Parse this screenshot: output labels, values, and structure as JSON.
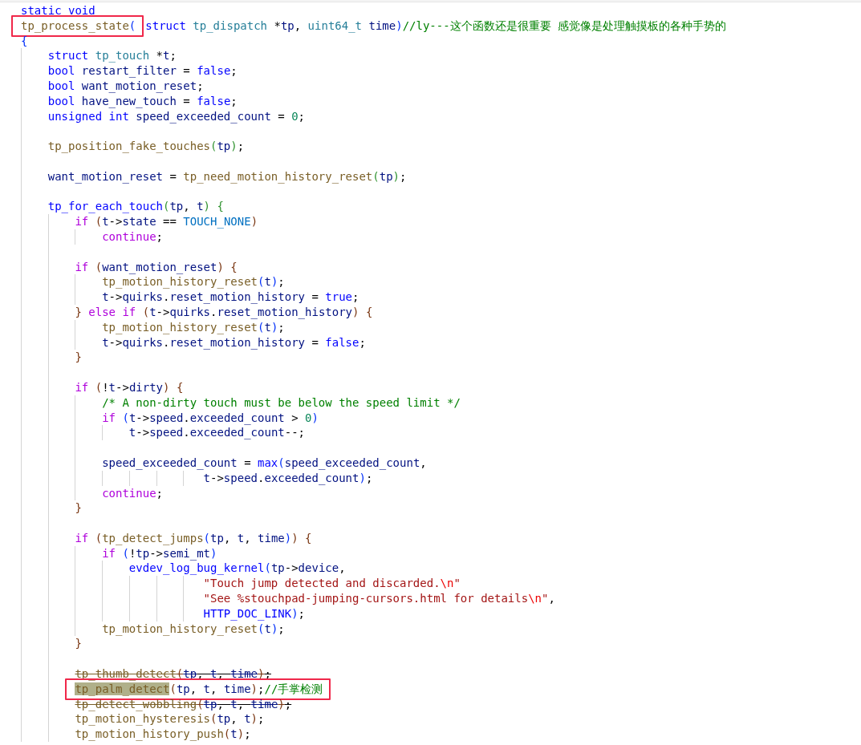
{
  "editor": {
    "lines": [
      {
        "kind": "code",
        "tokens": [
          {
            "text": "static void",
            "kind": "keyword"
          }
        ]
      },
      {
        "kind": "code",
        "boxed": [
          {
            "text": "tp_process_state",
            "kind": "function"
          },
          {
            "text": "(",
            "kind": "bracket"
          }
        ],
        "after": [
          {
            "text": "struct ",
            "kind": "keyword"
          },
          {
            "text": "tp_dispatch",
            "kind": "type"
          },
          {
            "text": " *",
            "kind": "plain"
          },
          {
            "text": "tp",
            "kind": "variable"
          },
          {
            "text": ", ",
            "kind": "plain"
          },
          {
            "text": "uint64_t",
            "kind": "type"
          },
          {
            "text": " time",
            "kind": "variable"
          },
          {
            "text": ")",
            "kind": "bracket"
          },
          {
            "text": "//ly---这个函数还是很重要 感觉像是处理触摸板的各种手势的",
            "kind": "comment"
          }
        ]
      },
      {
        "kind": "code",
        "tokens": [
          {
            "text": "{",
            "kind": "bracket"
          }
        ],
        "children": [
          {
            "kind": "code",
            "tokens": [
              {
                "text": "struct ",
                "kind": "keyword"
              },
              {
                "text": "tp_touch",
                "kind": "type"
              },
              {
                "text": " *",
                "kind": "plain"
              },
              {
                "text": "t",
                "kind": "variable"
              },
              {
                "text": ";",
                "kind": "plain"
              }
            ]
          },
          {
            "kind": "code",
            "tokens": [
              {
                "text": "bool ",
                "kind": "keyword"
              },
              {
                "text": "restart_filter",
                "kind": "variable"
              },
              {
                "text": " = ",
                "kind": "plain"
              },
              {
                "text": "false",
                "kind": "keyword"
              },
              {
                "text": ";",
                "kind": "plain"
              }
            ]
          },
          {
            "kind": "code",
            "tokens": [
              {
                "text": "bool ",
                "kind": "keyword"
              },
              {
                "text": "want_motion_reset",
                "kind": "variable"
              },
              {
                "text": ";",
                "kind": "plain"
              }
            ]
          },
          {
            "kind": "code",
            "tokens": [
              {
                "text": "bool ",
                "kind": "keyword"
              },
              {
                "text": "have_new_touch",
                "kind": "variable"
              },
              {
                "text": " = ",
                "kind": "plain"
              },
              {
                "text": "false",
                "kind": "keyword"
              },
              {
                "text": ";",
                "kind": "plain"
              }
            ]
          },
          {
            "kind": "code",
            "tokens": [
              {
                "text": "unsigned int ",
                "kind": "keyword"
              },
              {
                "text": "speed_exceeded_count",
                "kind": "variable"
              },
              {
                "text": " = ",
                "kind": "plain"
              },
              {
                "text": "0",
                "kind": "number"
              },
              {
                "text": ";",
                "kind": "plain"
              }
            ]
          },
          {
            "kind": "blank"
          },
          {
            "kind": "code",
            "tokens": [
              {
                "text": "tp_position_fake_touches",
                "kind": "function"
              },
              {
                "text": "(",
                "kind": "bracket2"
              },
              {
                "text": "tp",
                "kind": "variable"
              },
              {
                "text": ")",
                "kind": "bracket2"
              },
              {
                "text": ";",
                "kind": "plain"
              }
            ]
          },
          {
            "kind": "blank"
          },
          {
            "kind": "code",
            "tokens": [
              {
                "text": "want_motion_reset",
                "kind": "variable"
              },
              {
                "text": " = ",
                "kind": "plain"
              },
              {
                "text": "tp_need_motion_history_reset",
                "kind": "function"
              },
              {
                "text": "(",
                "kind": "bracket2"
              },
              {
                "text": "tp",
                "kind": "variable"
              },
              {
                "text": ")",
                "kind": "bracket2"
              },
              {
                "text": ";",
                "kind": "plain"
              }
            ]
          },
          {
            "kind": "blank"
          },
          {
            "kind": "code",
            "tokens": [
              {
                "text": "tp_for_each_touch",
                "kind": "keyword"
              },
              {
                "text": "(",
                "kind": "bracket2"
              },
              {
                "text": "tp",
                "kind": "variable"
              },
              {
                "text": ", ",
                "kind": "plain"
              },
              {
                "text": "t",
                "kind": "variable"
              },
              {
                "text": ")",
                "kind": "bracket2"
              },
              {
                "text": " {",
                "kind": "bracket2"
              }
            ],
            "children": [
              {
                "kind": "code",
                "tokens": [
                  {
                    "text": "if ",
                    "kind": "control"
                  },
                  {
                    "text": "(",
                    "kind": "bracket3"
                  },
                  {
                    "text": "t",
                    "kind": "variable"
                  },
                  {
                    "text": "->",
                    "kind": "plain"
                  },
                  {
                    "text": "state",
                    "kind": "variable"
                  },
                  {
                    "text": " == ",
                    "kind": "plain"
                  },
                  {
                    "text": "TOUCH_NONE",
                    "kind": "constant"
                  },
                  {
                    "text": ")",
                    "kind": "bracket3"
                  }
                ],
                "children": [
                  {
                    "kind": "code",
                    "tokens": [
                      {
                        "text": "continue",
                        "kind": "control"
                      },
                      {
                        "text": ";",
                        "kind": "plain"
                      }
                    ]
                  }
                ]
              },
              {
                "kind": "blank"
              },
              {
                "kind": "code",
                "tokens": [
                  {
                    "text": "if ",
                    "kind": "control"
                  },
                  {
                    "text": "(",
                    "kind": "bracket3"
                  },
                  {
                    "text": "want_motion_reset",
                    "kind": "variable"
                  },
                  {
                    "text": ")",
                    "kind": "bracket3"
                  },
                  {
                    "text": " {",
                    "kind": "bracket3"
                  }
                ],
                "children": [
                  {
                    "kind": "code",
                    "tokens": [
                      {
                        "text": "tp_motion_history_reset",
                        "kind": "function"
                      },
                      {
                        "text": "(",
                        "kind": "bracket"
                      },
                      {
                        "text": "t",
                        "kind": "variable"
                      },
                      {
                        "text": ")",
                        "kind": "bracket"
                      },
                      {
                        "text": ";",
                        "kind": "plain"
                      }
                    ]
                  },
                  {
                    "kind": "code",
                    "tokens": [
                      {
                        "text": "t",
                        "kind": "variable"
                      },
                      {
                        "text": "->",
                        "kind": "plain"
                      },
                      {
                        "text": "quirks",
                        "kind": "variable"
                      },
                      {
                        "text": ".",
                        "kind": "plain"
                      },
                      {
                        "text": "reset_motion_history",
                        "kind": "variable"
                      },
                      {
                        "text": " = ",
                        "kind": "plain"
                      },
                      {
                        "text": "true",
                        "kind": "keyword"
                      },
                      {
                        "text": ";",
                        "kind": "plain"
                      }
                    ]
                  }
                ]
              },
              {
                "kind": "code",
                "tokens": [
                  {
                    "text": "} ",
                    "kind": "bracket3"
                  },
                  {
                    "text": "else if ",
                    "kind": "control"
                  },
                  {
                    "text": "(",
                    "kind": "bracket3"
                  },
                  {
                    "text": "t",
                    "kind": "variable"
                  },
                  {
                    "text": "->",
                    "kind": "plain"
                  },
                  {
                    "text": "quirks",
                    "kind": "variable"
                  },
                  {
                    "text": ".",
                    "kind": "plain"
                  },
                  {
                    "text": "reset_motion_history",
                    "kind": "variable"
                  },
                  {
                    "text": ")",
                    "kind": "bracket3"
                  },
                  {
                    "text": " {",
                    "kind": "bracket3"
                  }
                ],
                "children": [
                  {
                    "kind": "code",
                    "tokens": [
                      {
                        "text": "tp_motion_history_reset",
                        "kind": "function"
                      },
                      {
                        "text": "(",
                        "kind": "bracket"
                      },
                      {
                        "text": "t",
                        "kind": "variable"
                      },
                      {
                        "text": ")",
                        "kind": "bracket"
                      },
                      {
                        "text": ";",
                        "kind": "plain"
                      }
                    ]
                  },
                  {
                    "kind": "code",
                    "tokens": [
                      {
                        "text": "t",
                        "kind": "variable"
                      },
                      {
                        "text": "->",
                        "kind": "plain"
                      },
                      {
                        "text": "quirks",
                        "kind": "variable"
                      },
                      {
                        "text": ".",
                        "kind": "plain"
                      },
                      {
                        "text": "reset_motion_history",
                        "kind": "variable"
                      },
                      {
                        "text": " = ",
                        "kind": "plain"
                      },
                      {
                        "text": "false",
                        "kind": "keyword"
                      },
                      {
                        "text": ";",
                        "kind": "plain"
                      }
                    ]
                  }
                ]
              },
              {
                "kind": "code",
                "tokens": [
                  {
                    "text": "}",
                    "kind": "bracket3"
                  }
                ]
              },
              {
                "kind": "blank"
              },
              {
                "kind": "code",
                "tokens": [
                  {
                    "text": "if ",
                    "kind": "control"
                  },
                  {
                    "text": "(",
                    "kind": "bracket3"
                  },
                  {
                    "text": "!",
                    "kind": "plain"
                  },
                  {
                    "text": "t",
                    "kind": "variable"
                  },
                  {
                    "text": "->",
                    "kind": "plain"
                  },
                  {
                    "text": "dirty",
                    "kind": "variable"
                  },
                  {
                    "text": ")",
                    "kind": "bracket3"
                  },
                  {
                    "text": " {",
                    "kind": "bracket3"
                  }
                ],
                "children": [
                  {
                    "kind": "code",
                    "tokens": [
                      {
                        "text": "/* A non-dirty touch must be below the speed limit */",
                        "kind": "comment"
                      }
                    ]
                  },
                  {
                    "kind": "code",
                    "tokens": [
                      {
                        "text": "if ",
                        "kind": "control"
                      },
                      {
                        "text": "(",
                        "kind": "bracket"
                      },
                      {
                        "text": "t",
                        "kind": "variable"
                      },
                      {
                        "text": "->",
                        "kind": "plain"
                      },
                      {
                        "text": "speed",
                        "kind": "variable"
                      },
                      {
                        "text": ".",
                        "kind": "plain"
                      },
                      {
                        "text": "exceeded_count",
                        "kind": "variable"
                      },
                      {
                        "text": " > ",
                        "kind": "plain"
                      },
                      {
                        "text": "0",
                        "kind": "number"
                      },
                      {
                        "text": ")",
                        "kind": "bracket"
                      }
                    ],
                    "children": [
                      {
                        "kind": "code",
                        "tokens": [
                          {
                            "text": "t",
                            "kind": "variable"
                          },
                          {
                            "text": "->",
                            "kind": "plain"
                          },
                          {
                            "text": "speed",
                            "kind": "variable"
                          },
                          {
                            "text": ".",
                            "kind": "plain"
                          },
                          {
                            "text": "exceeded_count",
                            "kind": "variable"
                          },
                          {
                            "text": "--;",
                            "kind": "plain"
                          }
                        ]
                      }
                    ]
                  },
                  {
                    "kind": "blank"
                  },
                  {
                    "kind": "code",
                    "tokens": [
                      {
                        "text": "speed_exceeded_count",
                        "kind": "variable"
                      },
                      {
                        "text": " = ",
                        "kind": "plain"
                      },
                      {
                        "text": "max",
                        "kind": "keyword"
                      },
                      {
                        "text": "(",
                        "kind": "bracket"
                      },
                      {
                        "text": "speed_exceeded_count",
                        "kind": "variable"
                      },
                      {
                        "text": ",",
                        "kind": "plain"
                      }
                    ],
                    "children": [
                      {
                        "kind": "continuation",
                        "tokens": [
                          {
                            "text": "t",
                            "kind": "variable"
                          },
                          {
                            "text": "->",
                            "kind": "plain"
                          },
                          {
                            "text": "speed",
                            "kind": "variable"
                          },
                          {
                            "text": ".",
                            "kind": "plain"
                          },
                          {
                            "text": "exceeded_count",
                            "kind": "variable"
                          },
                          {
                            "text": ")",
                            "kind": "bracket"
                          },
                          {
                            "text": ";",
                            "kind": "plain"
                          }
                        ]
                      }
                    ]
                  },
                  {
                    "kind": "code",
                    "tokens": [
                      {
                        "text": "continue",
                        "kind": "control"
                      },
                      {
                        "text": ";",
                        "kind": "plain"
                      }
                    ]
                  }
                ]
              },
              {
                "kind": "code",
                "tokens": [
                  {
                    "text": "}",
                    "kind": "bracket3"
                  }
                ]
              },
              {
                "kind": "blank"
              },
              {
                "kind": "code",
                "tokens": [
                  {
                    "text": "if ",
                    "kind": "control"
                  },
                  {
                    "text": "(",
                    "kind": "bracket3"
                  },
                  {
                    "text": "tp_detect_jumps",
                    "kind": "function"
                  },
                  {
                    "text": "(",
                    "kind": "bracket"
                  },
                  {
                    "text": "tp",
                    "kind": "variable"
                  },
                  {
                    "text": ", ",
                    "kind": "plain"
                  },
                  {
                    "text": "t",
                    "kind": "variable"
                  },
                  {
                    "text": ", ",
                    "kind": "plain"
                  },
                  {
                    "text": "time",
                    "kind": "variable"
                  },
                  {
                    "text": ")",
                    "kind": "bracket"
                  },
                  {
                    "text": ")",
                    "kind": "bracket3"
                  },
                  {
                    "text": " {",
                    "kind": "bracket3"
                  }
                ],
                "children": [
                  {
                    "kind": "code",
                    "tokens": [
                      {
                        "text": "if ",
                        "kind": "control"
                      },
                      {
                        "text": "(",
                        "kind": "bracket"
                      },
                      {
                        "text": "!",
                        "kind": "plain"
                      },
                      {
                        "text": "tp",
                        "kind": "variable"
                      },
                      {
                        "text": "->",
                        "kind": "plain"
                      },
                      {
                        "text": "semi_mt",
                        "kind": "variable"
                      },
                      {
                        "text": ")",
                        "kind": "bracket"
                      }
                    ],
                    "children": [
                      {
                        "kind": "code",
                        "tokens": [
                          {
                            "text": "evdev_log_bug_kernel",
                            "kind": "keyword"
                          },
                          {
                            "text": "(",
                            "kind": "bracket"
                          },
                          {
                            "text": "tp",
                            "kind": "variable"
                          },
                          {
                            "text": "->",
                            "kind": "plain"
                          },
                          {
                            "text": "device",
                            "kind": "variable"
                          },
                          {
                            "text": ",",
                            "kind": "plain"
                          }
                        ],
                        "children": [
                          {
                            "kind": "continuation",
                            "tokens": [
                              {
                                "text": "\"Touch jump detected and discarded.",
                                "kind": "string"
                              },
                              {
                                "text": "\\n",
                                "kind": "escape"
                              },
                              {
                                "text": "\"",
                                "kind": "string"
                              }
                            ]
                          },
                          {
                            "kind": "continuation",
                            "tokens": [
                              {
                                "text": "\"See %stouchpad-jumping-cursors.html for details",
                                "kind": "string"
                              },
                              {
                                "text": "\\n",
                                "kind": "escape"
                              },
                              {
                                "text": "\"",
                                "kind": "string"
                              },
                              {
                                "text": ",",
                                "kind": "plain"
                              }
                            ]
                          },
                          {
                            "kind": "continuation",
                            "tokens": [
                              {
                                "text": "HTTP_DOC_LINK",
                                "kind": "keyword"
                              },
                              {
                                "text": ")",
                                "kind": "bracket"
                              },
                              {
                                "text": ";",
                                "kind": "plain"
                              }
                            ]
                          }
                        ]
                      }
                    ]
                  },
                  {
                    "kind": "code",
                    "tokens": [
                      {
                        "text": "tp_motion_history_reset",
                        "kind": "function"
                      },
                      {
                        "text": "(",
                        "kind": "bracket"
                      },
                      {
                        "text": "t",
                        "kind": "variable"
                      },
                      {
                        "text": ")",
                        "kind": "bracket"
                      },
                      {
                        "text": ";",
                        "kind": "plain"
                      }
                    ]
                  }
                ]
              },
              {
                "kind": "code",
                "tokens": [
                  {
                    "text": "}",
                    "kind": "bracket3"
                  }
                ]
              },
              {
                "kind": "blank"
              },
              {
                "kind": "code",
                "struck": true,
                "tokens": [
                  {
                    "text": "tp_thumb_detect",
                    "kind": "function"
                  },
                  {
                    "text": "(",
                    "kind": "bracket3"
                  },
                  {
                    "text": "tp",
                    "kind": "variable"
                  },
                  {
                    "text": ", ",
                    "kind": "plain"
                  },
                  {
                    "text": "t",
                    "kind": "variable"
                  },
                  {
                    "text": ", ",
                    "kind": "plain"
                  },
                  {
                    "text": "time",
                    "kind": "variable"
                  },
                  {
                    "text": ")",
                    "kind": "bracket3"
                  },
                  {
                    "text": ";",
                    "kind": "plain"
                  }
                ]
              },
              {
                "kind": "code",
                "struck": false,
                "boxed": [
                  {
                    "text": "tp_palm_detect",
                    "kind": "match"
                  },
                  {
                    "text": "(",
                    "kind": "bracket3"
                  },
                  {
                    "text": "tp",
                    "kind": "variable"
                  },
                  {
                    "text": ", ",
                    "kind": "plain"
                  },
                  {
                    "text": "t",
                    "kind": "variable"
                  },
                  {
                    "text": ", ",
                    "kind": "plain"
                  },
                  {
                    "text": "time",
                    "kind": "variable"
                  },
                  {
                    "text": ")",
                    "kind": "bracket3"
                  },
                  {
                    "text": ";",
                    "kind": "plain"
                  },
                  {
                    "text": "//手掌检测",
                    "kind": "comment"
                  }
                ]
              },
              {
                "kind": "code",
                "struck": true,
                "tokens": [
                  {
                    "text": "tp_detect_wobbling",
                    "kind": "function"
                  },
                  {
                    "text": "(",
                    "kind": "bracket3"
                  },
                  {
                    "text": "tp",
                    "kind": "variable"
                  },
                  {
                    "text": ", ",
                    "kind": "plain"
                  },
                  {
                    "text": "t",
                    "kind": "variable"
                  },
                  {
                    "text": ", ",
                    "kind": "plain"
                  },
                  {
                    "text": "time",
                    "kind": "variable"
                  },
                  {
                    "text": ")",
                    "kind": "bracket3"
                  },
                  {
                    "text": ";",
                    "kind": "plain"
                  }
                ]
              },
              {
                "kind": "code",
                "struck": false,
                "tokens": [
                  {
                    "text": "tp_motion_hysteresis",
                    "kind": "function"
                  },
                  {
                    "text": "(",
                    "kind": "bracket3"
                  },
                  {
                    "text": "tp",
                    "kind": "variable"
                  },
                  {
                    "text": ", ",
                    "kind": "plain"
                  },
                  {
                    "text": "t",
                    "kind": "variable"
                  },
                  {
                    "text": ")",
                    "kind": "bracket3"
                  },
                  {
                    "text": ";",
                    "kind": "plain"
                  }
                ]
              },
              {
                "kind": "code",
                "struck": false,
                "tokens": [
                  {
                    "text": "tp_motion_history_push",
                    "kind": "function"
                  },
                  {
                    "text": "(",
                    "kind": "bracket3"
                  },
                  {
                    "text": "t",
                    "kind": "variable"
                  },
                  {
                    "text": ")",
                    "kind": "bracket3"
                  },
                  {
                    "text": ";",
                    "kind": "plain"
                  }
                ]
              }
            ]
          }
        ]
      }
    ]
  }
}
